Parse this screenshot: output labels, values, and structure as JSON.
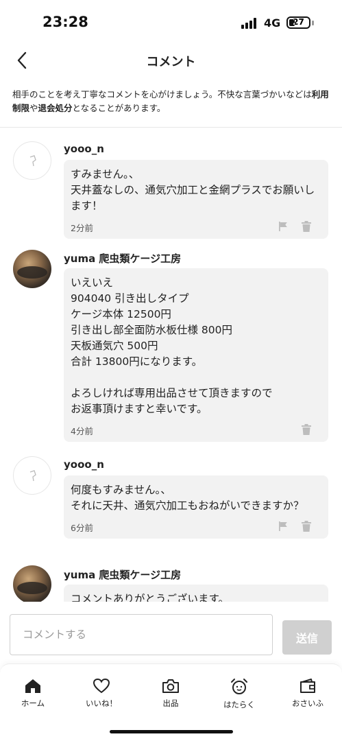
{
  "status": {
    "time": "23:28",
    "network": "4G",
    "battery": "27"
  },
  "header": {
    "title": "コメント"
  },
  "notice": {
    "part1": "相手のことを考え丁寧なコメントを心がけましょう。不快な言葉づかいなどは",
    "bold1": "利用制限",
    "part2": "や",
    "bold2": "退会処分",
    "part3": "となることがあります。"
  },
  "comments": [
    {
      "user": "yooo_n",
      "text": "すみません。、\n天井蓋なしの、通気穴加工と金網プラスでお願いします！",
      "time": "2分前",
      "show_flag": true
    },
    {
      "user": "yuma 爬虫類ケージ工房",
      "text": "いえいえ\n904040 引き出しタイプ\nケージ本体 12500円\n引き出し部全面防水板仕様 800円\n天板通気穴 500円\n合計 13800円になります。\n\nよろしければ専用出品させて頂きますので\nお返事頂けますと幸いです。",
      "time": "4分前",
      "show_flag": false
    },
    {
      "user": "yooo_n",
      "text": "何度もすみません。、\nそれに天井、通気穴加工もおねがいできますか？",
      "time": "6分前",
      "show_flag": true
    },
    {
      "user": "yuma 爬虫類ケージ工房",
      "text": "コメントありがとうございます。",
      "time": "",
      "show_flag": false
    }
  ],
  "composer": {
    "placeholder": "コメントする",
    "send_label": "送信"
  },
  "tabs": [
    {
      "label": "ホーム",
      "icon": "home-icon"
    },
    {
      "label": "いいね！",
      "icon": "heart-icon"
    },
    {
      "label": "出品",
      "icon": "camera-icon"
    },
    {
      "label": "はたらく",
      "icon": "alarm-clock-icon"
    },
    {
      "label": "おさいふ",
      "icon": "wallet-icon"
    }
  ]
}
